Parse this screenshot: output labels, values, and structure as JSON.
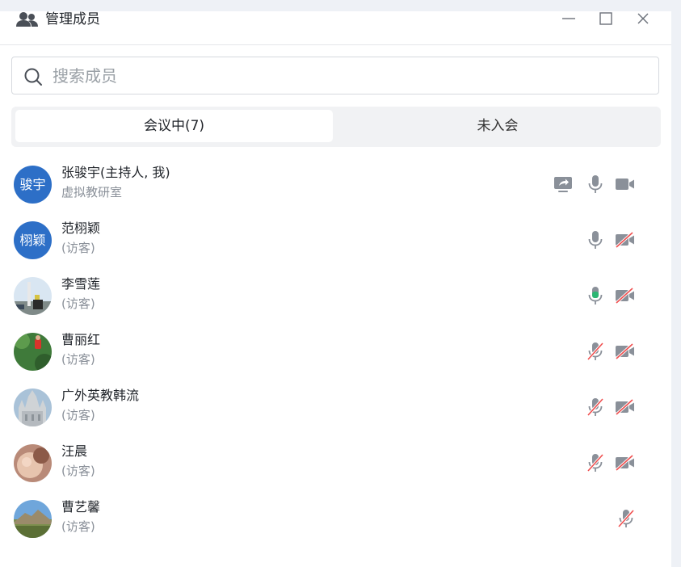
{
  "window": {
    "title": "管理成员"
  },
  "search": {
    "placeholder": "搜索成员",
    "value": ""
  },
  "tabs": [
    {
      "label": "会议中(7)",
      "active": true
    },
    {
      "label": "未入会",
      "active": false
    }
  ],
  "members": [
    {
      "name": "张骏宇(主持人, 我)",
      "sub": "虚拟教研室",
      "avatar_text": "骏宇",
      "avatar_type": "text",
      "share": true,
      "mic": "on",
      "camera": "on"
    },
    {
      "name": "范栩颖",
      "sub": "(访客)",
      "avatar_text": "栩颖",
      "avatar_type": "text",
      "share": false,
      "mic": "on",
      "camera": "off"
    },
    {
      "name": "李雪莲",
      "sub": "(访客)",
      "avatar_type": "photo-sky",
      "share": false,
      "mic": "speaking",
      "camera": "off"
    },
    {
      "name": "曹丽红",
      "sub": "(访客)",
      "avatar_type": "photo-green",
      "share": false,
      "mic": "off",
      "camera": "off"
    },
    {
      "name": "广外英教韩流",
      "sub": "(访客)",
      "avatar_type": "photo-building",
      "share": false,
      "mic": "off",
      "camera": "off"
    },
    {
      "name": "汪晨",
      "sub": "(访客)",
      "avatar_type": "photo-baby",
      "share": false,
      "mic": "off",
      "camera": "off"
    },
    {
      "name": "曹艺馨",
      "sub": "(访客)",
      "avatar_type": "photo-mountain",
      "share": false,
      "mic": "off",
      "camera": "none"
    }
  ],
  "colors": {
    "accent_blue": "#2d6fc7",
    "speaking_green": "#2bb673",
    "muted_red": "#f05050",
    "icon_gray": "#8a9099"
  },
  "icons": [
    "users-icon",
    "minimize-icon",
    "maximize-icon",
    "close-icon",
    "search-icon",
    "share-screen-icon",
    "mic-icon",
    "camera-icon"
  ]
}
